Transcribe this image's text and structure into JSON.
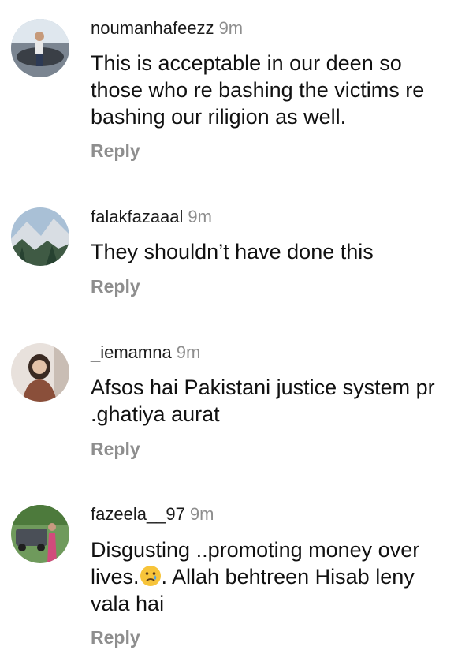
{
  "comments": [
    {
      "username": "noumanhafeezz",
      "time": "9m",
      "text": "This is acceptable in our deen so those who re bashing the victims re bashing our riligion as well.",
      "reply": "Reply"
    },
    {
      "username": "falakfazaaal",
      "time": "9m",
      "text": "They shouldn’t have done this",
      "reply": "Reply"
    },
    {
      "username": "_iemamna",
      "time": "9m",
      "text": "Afsos hai Pakistani justice system pr .ghatiya aurat",
      "reply": "Reply"
    },
    {
      "username": "fazeela__97",
      "time": "9m",
      "text_part1": "Disgusting ..promoting money over lives.",
      "emoji": "crying-face-emoji",
      "text_part2": ". Allah behtreen Hisab leny vala hai",
      "reply": "Reply"
    }
  ]
}
